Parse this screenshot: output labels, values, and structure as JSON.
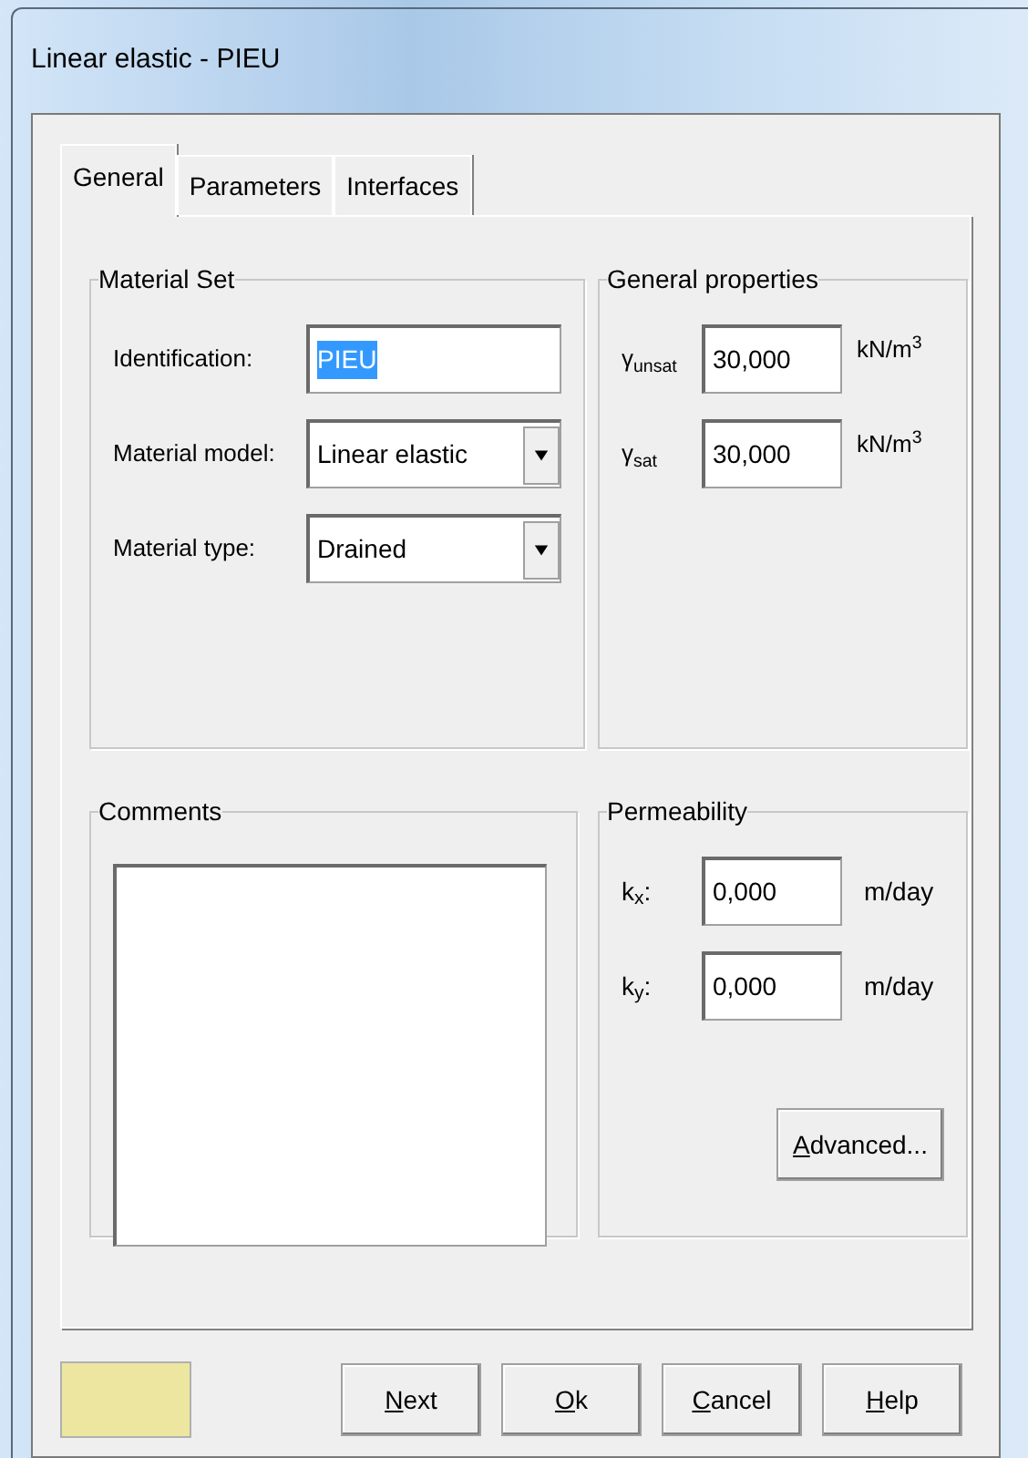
{
  "window": {
    "title": "Linear elastic - PIEU"
  },
  "tabs": [
    {
      "label": "General",
      "selected": true
    },
    {
      "label": "Parameters",
      "selected": false
    },
    {
      "label": "Interfaces",
      "selected": false
    }
  ],
  "material_set": {
    "title": "Material Set",
    "fields": [
      {
        "kind": "text",
        "label": "Identification:",
        "value": "PIEU",
        "text_selected": true
      },
      {
        "kind": "dropdown",
        "label": "Material model:",
        "value": "Linear elastic"
      },
      {
        "kind": "dropdown",
        "label": "Material type:",
        "value": "Drained"
      }
    ]
  },
  "general_properties": {
    "title": "General properties",
    "fields": [
      {
        "label": "γ$_{unsat}$",
        "value": "30,000",
        "unit": "kN/m$^{3}$"
      },
      {
        "label": "γ$_{sat}$",
        "value": "30,000",
        "unit": "kN/m$^{3}$"
      }
    ]
  },
  "comments": {
    "title": "Comments"
  },
  "permeability": {
    "title": "Permeability",
    "fields": [
      {
        "label": "k$_{x}$:",
        "value": "0,000",
        "unit": "m/day"
      },
      {
        "label": "k$_{y}$:",
        "value": "0,000",
        "unit": "m/day"
      }
    ],
    "button": {
      "label": "Advanced...",
      "underline_first": true
    }
  },
  "status_swatch": {
    "color": "#ede6a0"
  },
  "buttons": [
    {
      "label": "Next",
      "underline_first": true
    },
    {
      "label": "Ok",
      "underline_first": true
    },
    {
      "label": "Cancel",
      "underline_first": true
    },
    {
      "label": "Help",
      "underline_first": true
    }
  ]
}
